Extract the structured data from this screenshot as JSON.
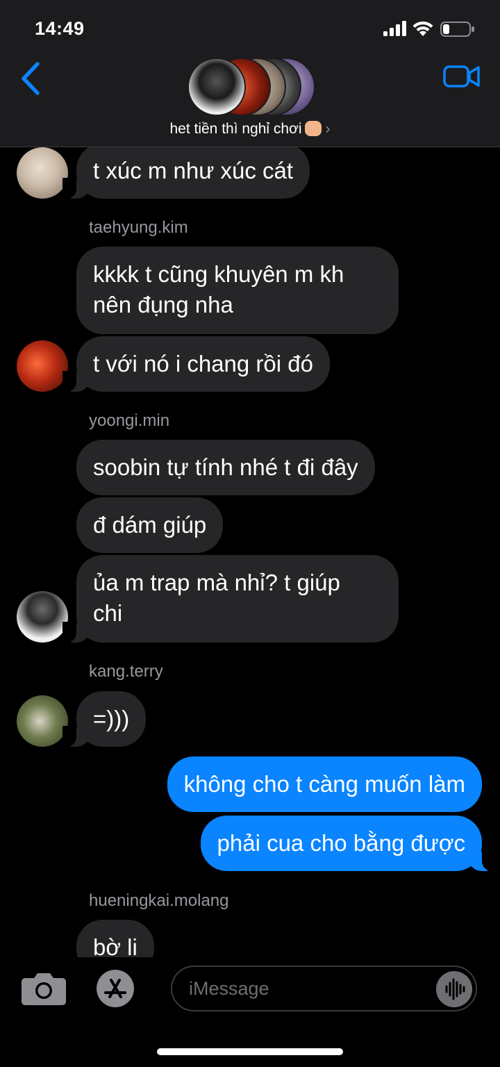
{
  "status_bar": {
    "time": "14:49",
    "battery_level": 0.25
  },
  "header": {
    "group_name": "het tiền thì nghỉ chơi",
    "group_emoji": "fist-emoji",
    "back_icon": "chevron-left-icon",
    "video_icon": "video-camera-icon"
  },
  "messages": [
    {
      "text": "t xúc m như xúc cát",
      "direction": "incoming",
      "avatar": "avatar-a"
    },
    {
      "sender": "taehyung.kim"
    },
    {
      "text": "kkkk t cũng khuyên m kh",
      "text2": "nên đụng nha",
      "direction": "incoming"
    },
    {
      "text": "t với nó i chang rồi đó",
      "direction": "incoming",
      "avatar": "avatar-b"
    },
    {
      "sender": "yoongi.min"
    },
    {
      "text": "soobin tự tính nhé t đi đây",
      "direction": "incoming"
    },
    {
      "text": "đ dám giúp",
      "direction": "incoming"
    },
    {
      "text": "ủa m trap mà nhỉ? t giúp",
      "text2": "chi",
      "direction": "incoming",
      "avatar": "avatar-c"
    },
    {
      "sender": "kang.terry"
    },
    {
      "text": "=)))",
      "direction": "incoming",
      "avatar": "avatar-d"
    },
    {
      "text": "không cho t càng muốn làm",
      "direction": "outgoing"
    },
    {
      "text": "phải cua cho bằng được",
      "direction": "outgoing"
    },
    {
      "sender": "hueningkai.molang"
    },
    {
      "text": "bờ li",
      "direction": "incoming"
    }
  ],
  "composer": {
    "placeholder": "iMessage",
    "camera_icon": "camera-icon",
    "apps_icon": "app-store-icon",
    "audio_icon": "audio-waveform-icon"
  },
  "colors": {
    "accent": "#0a84ff",
    "incoming_bubble": "#262628",
    "background": "#000000",
    "header": "#1c1c1e",
    "sender_text": "#98989f"
  }
}
